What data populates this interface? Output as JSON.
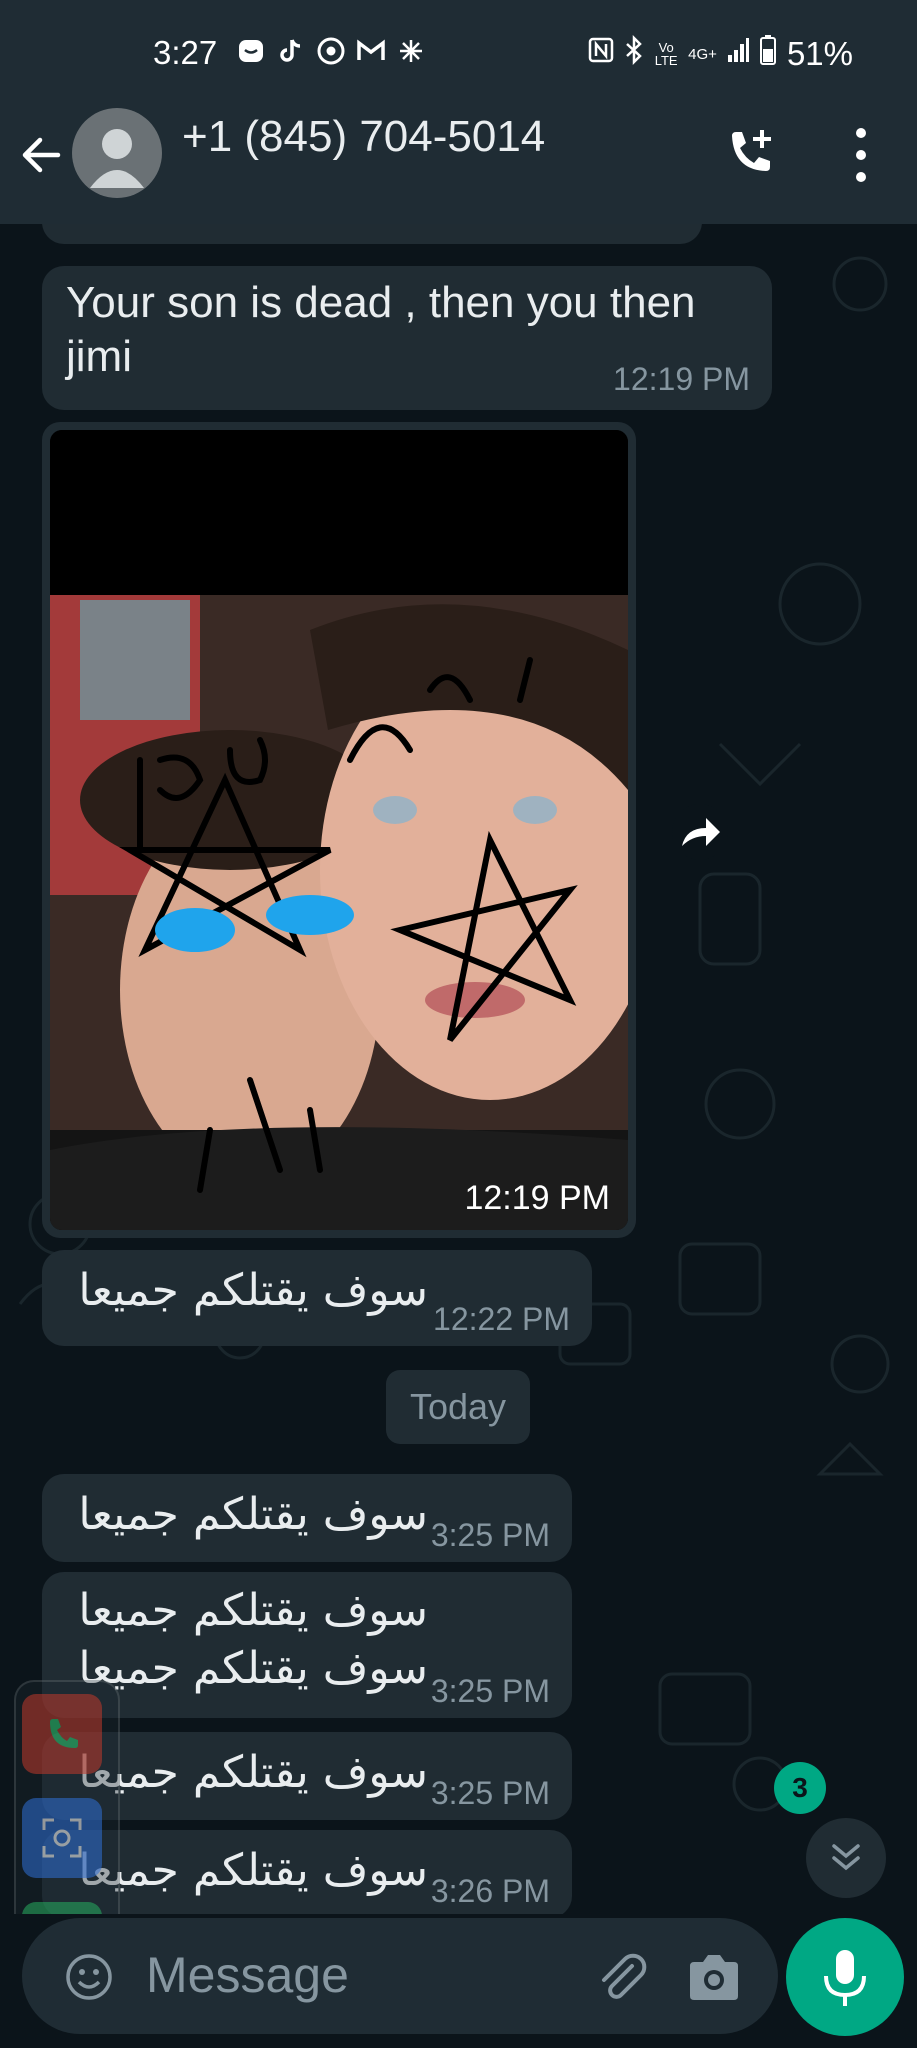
{
  "status_bar": {
    "time": "3:27",
    "battery": "51%",
    "network": "4G+",
    "volte": "Vo LTE",
    "left_icons": [
      "messenger-icon",
      "tiktok-icon",
      "chrome-icon",
      "gmail-icon",
      "asterisk-icon"
    ],
    "right_icons": [
      "nfc-icon",
      "bluetooth-icon",
      "volte-icon",
      "signal-icon",
      "battery-icon"
    ]
  },
  "header": {
    "contact": "+1 (845) 704-5014",
    "icons": [
      "back-arrow-icon",
      "avatar-icon",
      "add-call-icon",
      "more-vert-icon"
    ]
  },
  "messages": [
    {
      "text": "Your son is dead , then you then jimi",
      "time": "12:19 PM"
    },
    {
      "type": "image",
      "time": "12:19 PM"
    },
    {
      "text": "سوف يقتلكم جميعا",
      "time": "12:22 PM"
    }
  ],
  "date_divider": "Today",
  "today_messages": [
    {
      "text": "سوف يقتلكم جميعا",
      "time": "3:25 PM"
    },
    {
      "text_lines": [
        "سوف يقتلكم جميعا",
        "سوف يقتلكم جميعا"
      ],
      "time": "3:25 PM"
    },
    {
      "text": "سوف يقتلكم جميعا",
      "time": "3:25 PM"
    },
    {
      "text": "سوف يقتلكم جميعا",
      "time": "3:26 PM"
    }
  ],
  "unread_count": "3",
  "composer": {
    "placeholder": "Message",
    "icons": [
      "emoji-icon",
      "attach-icon",
      "camera-icon",
      "mic-icon"
    ]
  },
  "colors": {
    "header_bg": "#1f2c34",
    "chat_bg": "#0b141a",
    "bubble_bg": "#202c33",
    "accent": "#00a884",
    "text": "#e9edef",
    "meta": "#8696a0"
  }
}
